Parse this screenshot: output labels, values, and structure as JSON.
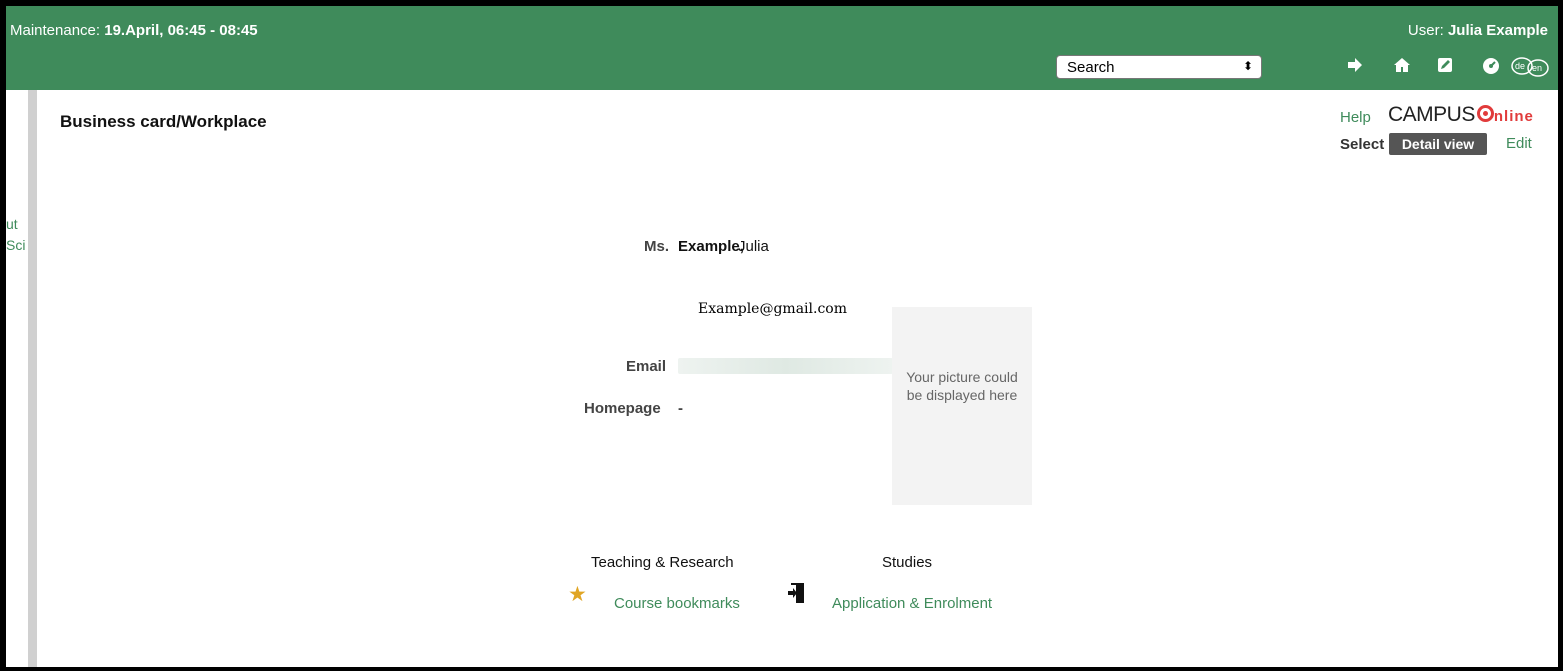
{
  "header": {
    "maintenance_label": "Maintenance: ",
    "maintenance_value": "19.April, 06:45 - 08:45",
    "user_label": "User: ",
    "user_name": "Julia Example",
    "search_value": "Search",
    "icons": [
      "logout-icon",
      "home-icon",
      "edit-icon",
      "dashboard-icon",
      "language-de-en-icon"
    ],
    "lang_de": "de",
    "lang_en": "en",
    "color": "#3f8b5b"
  },
  "sidebar": {
    "cut_text_1": "ut",
    "cut_text_2": "Sci"
  },
  "page": {
    "title": "Business card/Workplace",
    "help": "Help",
    "logo_campus": "CAMPUS",
    "logo_online": "nline",
    "select": "Select",
    "detail_view": "Detail view",
    "edit": "Edit"
  },
  "card": {
    "salutation": "Ms.",
    "surname": "Example,",
    "given_name": "Julia",
    "email_overlay": "Example@gmail.com",
    "email_label": "Email",
    "homepage_label": "Homepage",
    "homepage_value": "-",
    "photo_placeholder": "Your picture could be displayed here"
  },
  "links": {
    "teaching_title": "Teaching & Research",
    "studies_title": "Studies",
    "course_bookmarks": "Course bookmarks",
    "application_enrolment": "Application & Enrolment"
  }
}
